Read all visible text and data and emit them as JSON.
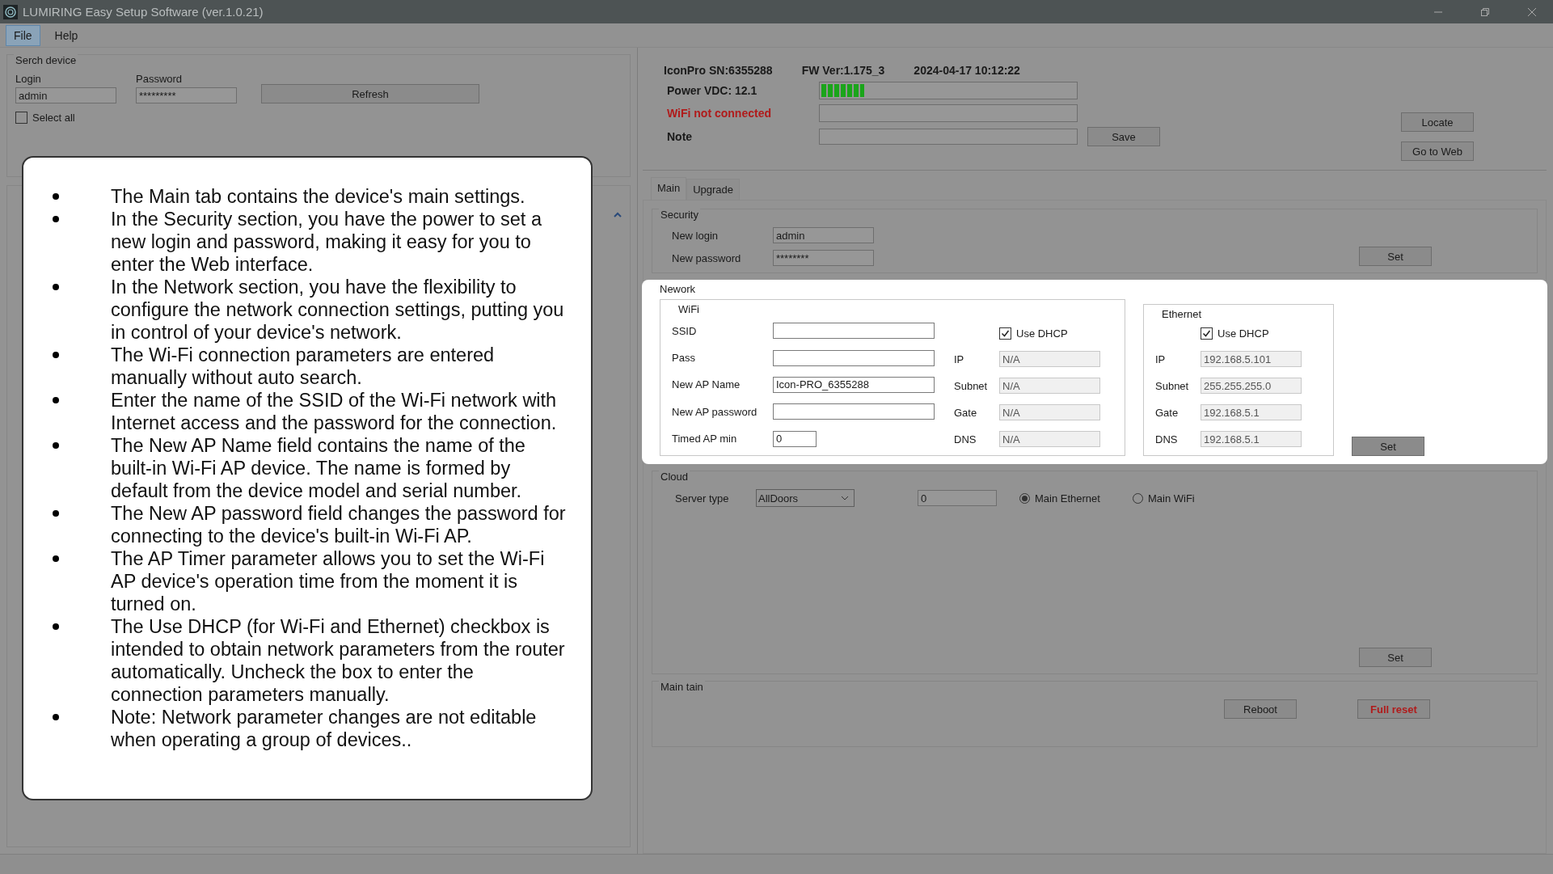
{
  "window": {
    "title": "LUMIRING Easy Setup Software (ver.1.0.21)"
  },
  "menu": [
    {
      "label": "File",
      "selected": true
    },
    {
      "label": "Help",
      "selected": false
    }
  ],
  "search_device": {
    "title": "Serch device",
    "login_label": "Login",
    "login_value": "admin",
    "password_label": "Password",
    "password_value": "*********",
    "refresh_button": "Refresh",
    "select_all": {
      "label": "Select all",
      "checked": false
    }
  },
  "device_info": {
    "serial": "IconPro SN:6355288",
    "firmware": "FW Ver:1.175_3",
    "datetime": "2024-04-17 10:12:22",
    "power_label": "Power VDC: 12.1",
    "power": {
      "level": 0.17
    },
    "wifi_status": "WiFi not connected",
    "wifi_connected": false,
    "note_label": "Note",
    "save_button": "Save",
    "locate_button": "Locate",
    "web_button": "Go to Web"
  },
  "tabs": [
    {
      "label": "Main",
      "selected": true
    },
    {
      "label": "Upgrade",
      "selected": false
    }
  ],
  "security": {
    "title": "Security",
    "login_label": "New login",
    "login_value": "admin",
    "password_label": "New password",
    "password_value": "********",
    "set_button": "Set"
  },
  "network": {
    "title": "Nework",
    "highlighted": true,
    "wifi": {
      "title": "WiFi",
      "fields": [
        {
          "label": "SSID"
        },
        {
          "label": "Pass"
        },
        {
          "label": "New AP Name",
          "value": "Icon-PRO_6355288"
        },
        {
          "label": "New AP password"
        },
        {
          "label": "Timed AP min",
          "value": "0",
          "kind": "short"
        }
      ],
      "dhcp": {
        "label": "Use DHCP",
        "checked": true
      },
      "params": [
        {
          "label": "IP",
          "value": "N/A",
          "disabled": true
        },
        {
          "label": "Subnet",
          "value": "N/A",
          "disabled": true
        },
        {
          "label": "Gate",
          "value": "N/A",
          "disabled": true
        },
        {
          "label": "DNS",
          "value": "N/A",
          "disabled": true
        }
      ]
    },
    "ethernet": {
      "title": "Ethernet",
      "dhcp": {
        "label": "Use DHCP",
        "checked": true
      },
      "params": [
        {
          "label": "IP",
          "value": "192.168.5.101",
          "disabled": true
        },
        {
          "label": "Subnet",
          "value": "255.255.255.0",
          "disabled": true
        },
        {
          "label": "Gate",
          "value": "192.168.5.1",
          "disabled": true
        },
        {
          "label": "DNS",
          "value": "192.168.5.1",
          "disabled": true
        }
      ]
    },
    "set_button": "Set"
  },
  "cloud": {
    "title": "Cloud",
    "server_label": "Server type",
    "server_value": "AllDoors",
    "port_value": "0",
    "modes": [
      {
        "label": "Main Ethernet",
        "selected": true
      },
      {
        "label": "Main WiFi",
        "selected": false
      }
    ],
    "set_button": "Set"
  },
  "maintain": {
    "title": "Main tain",
    "reboot_button": "Reboot",
    "reset_button": "Full reset"
  },
  "callout": {
    "items": [
      "The Main tab contains the device's main settings.",
      "In the Security section, you have the power to set a new login and password, making it easy for you to enter the Web interface.",
      "In the Network section, you have the flexibility to configure the network connection settings, putting you in control of your device's network.",
      "The Wi-Fi connection parameters are entered manually without auto search.",
      "Enter the name of the SSID of the Wi-Fi network with Internet access and the password for the connection.",
      "The New AP Name field contains the name of the built-in Wi-Fi AP device. The name is formed by default from the device model and serial number.",
      "The New AP password field changes the password for connecting to the device's built-in Wi-Fi AP.",
      "The AP Timer parameter allows you to set the Wi-Fi AP device's operation time from the moment it is turned on.",
      "The Use DHCP (for Wi-Fi and Ethernet) checkbox is intended to obtain network parameters from the router automatically. Uncheck the box to enter the connection parameters manually.",
      "Note: Network parameter changes are not editable when operating a group of devices.."
    ]
  }
}
